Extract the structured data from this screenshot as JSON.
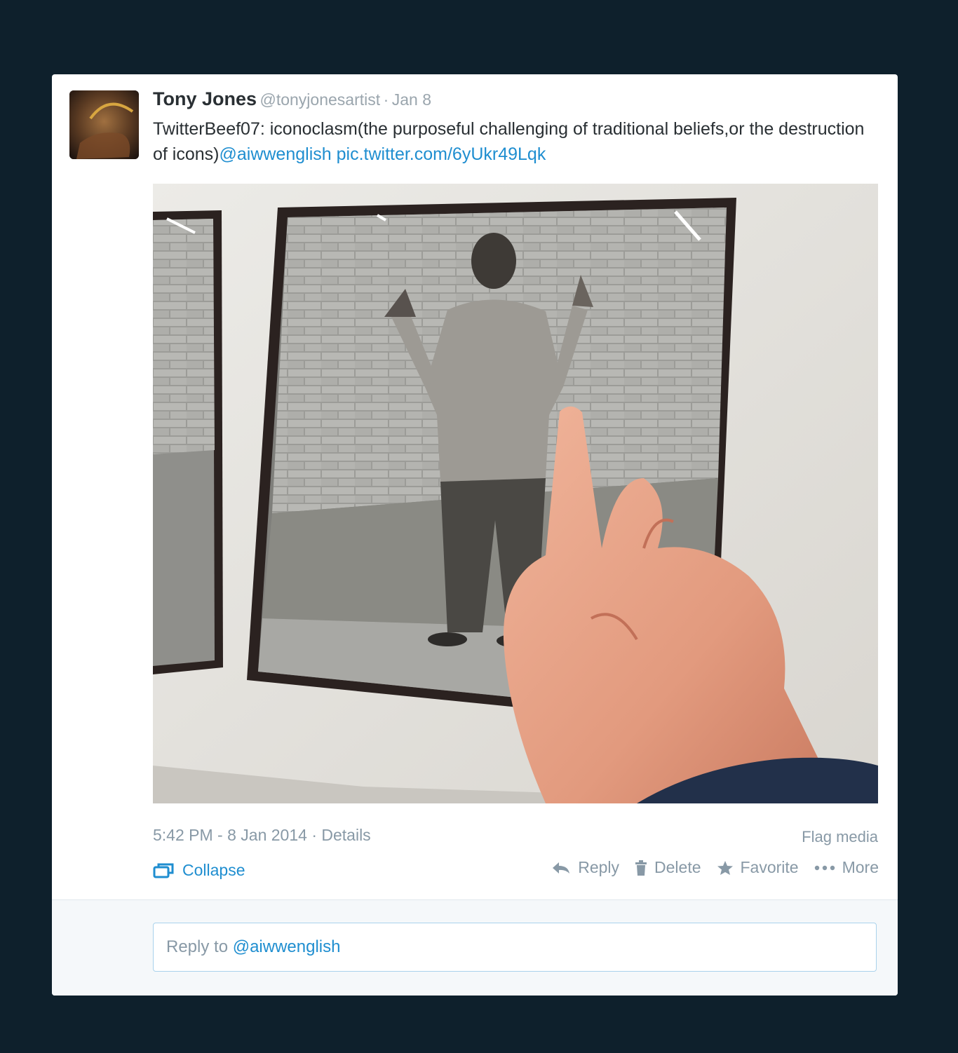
{
  "tweet": {
    "fullname": "Tony Jones",
    "handle": "@tonyjonesartist",
    "separator": "·",
    "date": "Jan 8",
    "text_plain": "TwitterBeef07: iconoclasm(the purposeful challenging of traditional beliefs,or the destruction of icons)",
    "mention_link": "@aiwwenglish",
    "pic_link": "pic.twitter.com/6yUkr49Lqk"
  },
  "meta": {
    "timestamp": "5:42 PM - 8 Jan 2014",
    "separator": "·",
    "details": "Details",
    "flag_media": "Flag media"
  },
  "actions": {
    "collapse": "Collapse",
    "reply": "Reply",
    "delete": "Delete",
    "favorite": "Favorite",
    "more": "More"
  },
  "reply_box": {
    "prefix": "Reply to",
    "mention": "@aiwwenglish"
  },
  "colors": {
    "page_background": "#0e202c",
    "link": "#1f8ed0",
    "muted": "#8899a6",
    "text": "#292f33"
  }
}
